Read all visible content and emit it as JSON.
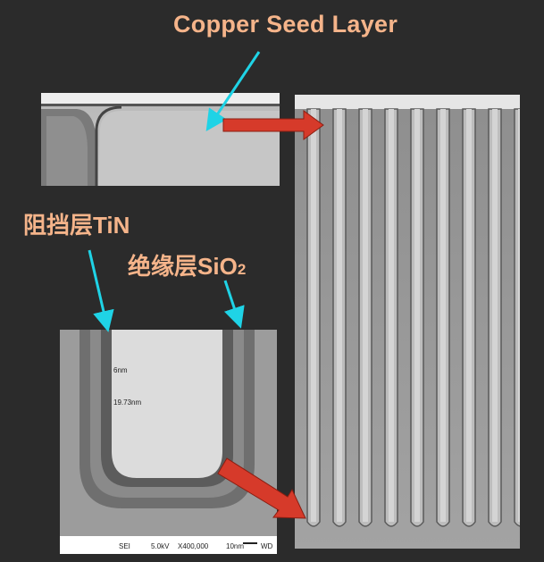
{
  "labels": {
    "title": "Copper Seed Layer",
    "barrier_prefix": "阻挡层",
    "barrier_suffix": "TiN",
    "insulator_prefix": "绝缘层",
    "insulator_suffix": "SiO",
    "insulator_subscript": "2"
  },
  "sem_bar": {
    "detector": "SEI",
    "voltage": "5.0kV",
    "magnification": "X400,000",
    "scale": "10nm",
    "wd": "WD"
  },
  "annotations": {
    "measure_1": "6nm",
    "measure_2": "19.73nm"
  },
  "colors": {
    "background": "#2b2b2b",
    "label": "#f5b48a",
    "pointer": "#1fd3e6",
    "red_arrow": "#d63a2a"
  }
}
